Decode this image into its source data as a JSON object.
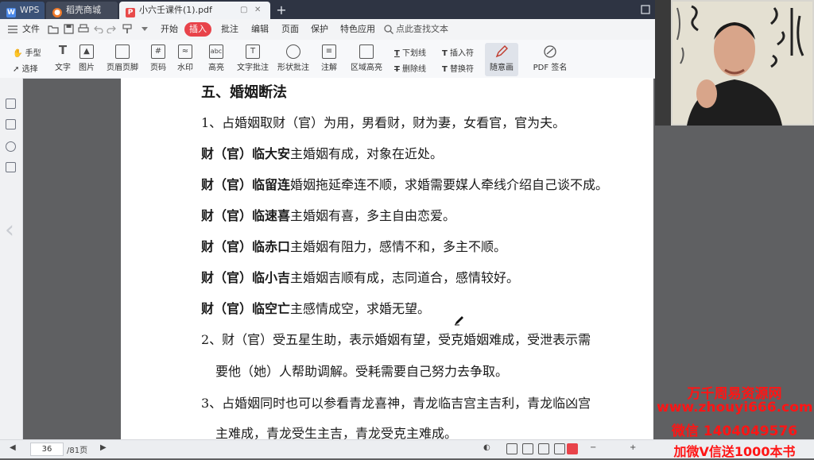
{
  "tabs": {
    "wps": "WPS",
    "store": "稻壳商城",
    "active": "小六壬课件(1).pdf",
    "new_tab": "+"
  },
  "menu": {
    "file": "文件",
    "items": [
      "开始",
      "插入",
      "批注",
      "编辑",
      "页面",
      "保护",
      "特色应用"
    ],
    "active_index": 1,
    "search": "点此查找文本"
  },
  "toolbar": {
    "hand": "手型",
    "select": "选择",
    "text": "文字",
    "image": "图片",
    "header_footer": "页眉页脚",
    "page_num": "页码",
    "watermark": "水印",
    "highlight": "高亮",
    "text_annotation": "文字批注",
    "shape_annotation": "形状批注",
    "note": "注解",
    "area_highlight": "区域高亮",
    "underline": "下划线",
    "strikethrough": "删除线",
    "insert_char": "插入符",
    "replace_char": "替换符",
    "freehand": "随意画",
    "pdf_sign": "PDF 签名"
  },
  "document": {
    "heading": "五、婚姻断法",
    "p1": "1、占婚姻取财（官）为用，男看财，财为妻，女看官，官为夫。",
    "items": [
      {
        "bold": "财（官）临大安",
        "text": "主婚姻有成，对象在近处。"
      },
      {
        "bold": "财（官）临留连",
        "text": "婚姻拖延牵连不顺，求婚需要媒人牵线介绍自己谈不成。"
      },
      {
        "bold": "财（官）临速喜",
        "text": "主婚姻有喜，多主自由恋爱。"
      },
      {
        "bold": "财（官）临赤口",
        "text": "主婚姻有阻力，感情不和，多主不顺。"
      },
      {
        "bold": "财（官）临小吉",
        "text": "主婚姻吉顺有成，志同道合，感情较好。"
      },
      {
        "bold": "财（官）临空亡",
        "text": "主感情成空，求婚无望。"
      }
    ],
    "p2_line1": "2、财（官）受五星生助，表示婚姻有望，受克婚姻难成，受泄表示需",
    "p2_line2": "要他（她）人帮助调解。受耗需要自己努力去争取。",
    "p3_line1": "3、占婚姻同时也可以参看青龙喜神，青龙临吉宫主吉利，青龙临凶宫",
    "p3_line2": "主难成，青龙受生主吉，青龙受克主难成。"
  },
  "statusbar": {
    "page": "36",
    "total": "/81页"
  },
  "watermark": {
    "line1": "万千周易资源网",
    "line2": "www.zhouyi666.com",
    "line3": "微信 1404049576",
    "line4": "加微V信送1000本书"
  },
  "colors": {
    "accent": "#e8434a",
    "watermark": "#ff1515",
    "tabbar": "#2e3443"
  }
}
